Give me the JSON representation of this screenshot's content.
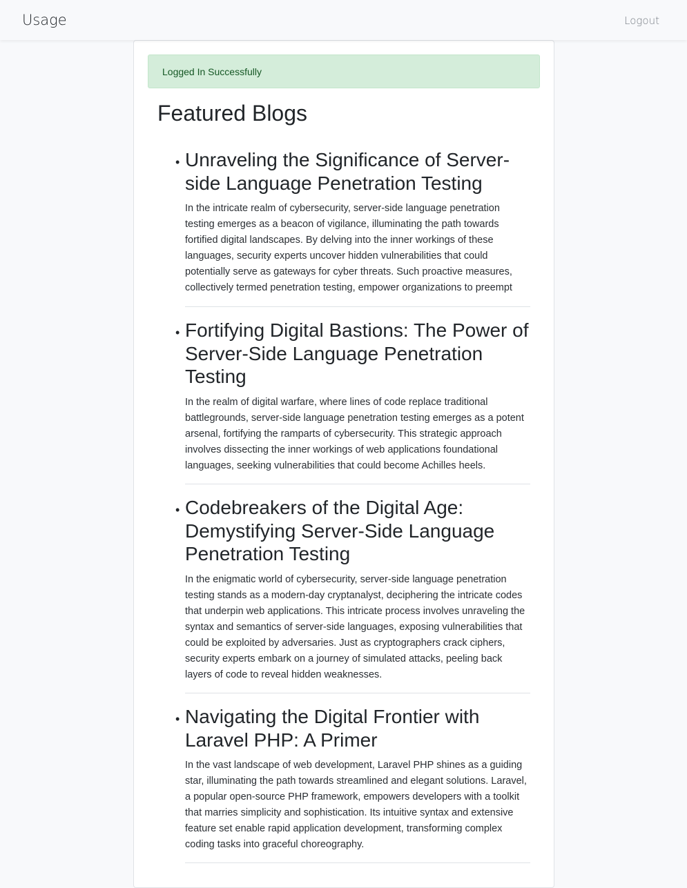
{
  "navbar": {
    "brand": "Usage",
    "logout_label": "Logout"
  },
  "alert": {
    "message": "Logged In Successfully"
  },
  "main": {
    "section_title": "Featured Blogs",
    "blogs": [
      {
        "title": "Unraveling the Significance of Server-side Language Penetration Testing",
        "excerpt": "In the intricate realm of cybersecurity, server-side language penetration testing emerges as a beacon of vigilance, illuminating the path towards fortified digital landscapes. By delving into the inner workings of these languages, security experts uncover hidden vulnerabilities that could potentially serve as gateways for cyber threats. Such proactive measures, collectively termed penetration testing, empower organizations to preempt"
      },
      {
        "title": "Fortifying Digital Bastions: The Power of Server-Side Language Penetration Testing",
        "excerpt": "In the realm of digital warfare, where lines of code replace traditional battlegrounds, server-side language penetration testing emerges as a potent arsenal, fortifying the ramparts of cybersecurity. This strategic approach involves dissecting the inner workings of web applications foundational languages, seeking vulnerabilities that could become Achilles heels."
      },
      {
        "title": "Codebreakers of the Digital Age: Demystifying Server-Side Language Penetration Testing",
        "excerpt": "In the enigmatic world of cybersecurity, server-side language penetration testing stands as a modern-day cryptanalyst, deciphering the intricate codes that underpin web applications. This intricate process involves unraveling the syntax and semantics of server-side languages, exposing vulnerabilities that could be exploited by adversaries. Just as cryptographers crack ciphers, security experts embark on a journey of simulated attacks, peeling back layers of code to reveal hidden weaknesses."
      },
      {
        "title": "Navigating the Digital Frontier with Laravel PHP: A Primer",
        "excerpt": "In the vast landscape of web development, Laravel PHP shines as a guiding star, illuminating the path towards streamlined and elegant solutions. Laravel, a popular open-source PHP framework, empowers developers with a toolkit that marries simplicity and sophistication. Its intuitive syntax and extensive feature set enable rapid application development, transforming complex coding tasks into graceful choreography."
      }
    ]
  }
}
